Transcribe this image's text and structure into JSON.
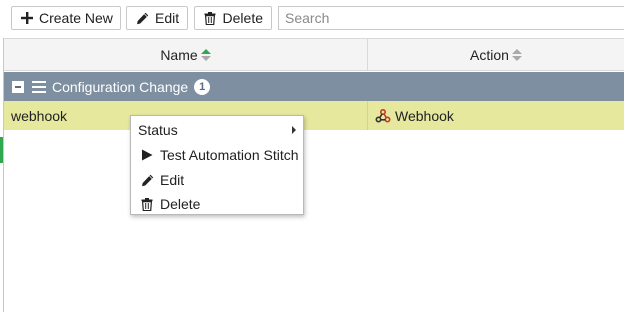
{
  "toolbar": {
    "create_label": "Create New",
    "edit_label": "Edit",
    "delete_label": "Delete",
    "search_placeholder": "Search"
  },
  "table": {
    "columns": [
      {
        "label": "Name",
        "sort": "ascending"
      },
      {
        "label": "Action",
        "sort": "none"
      }
    ],
    "group": {
      "label": "Configuration Change",
      "count": "1"
    },
    "rows": [
      {
        "name": "webhook",
        "action": "Webhook"
      }
    ]
  },
  "context_menu": {
    "items": [
      {
        "label": "Status",
        "has_submenu": true
      },
      {
        "label": "Test Automation Stitch",
        "icon": "play-icon"
      },
      {
        "label": "Edit",
        "icon": "pencil-icon"
      },
      {
        "label": "Delete",
        "icon": "trash-icon"
      }
    ]
  },
  "colors": {
    "group_bg": "#7d8fa0",
    "selected_row_bg": "#e6e89e",
    "sort_active": "#2fa84f",
    "webhook_icon": "#c0392b"
  }
}
